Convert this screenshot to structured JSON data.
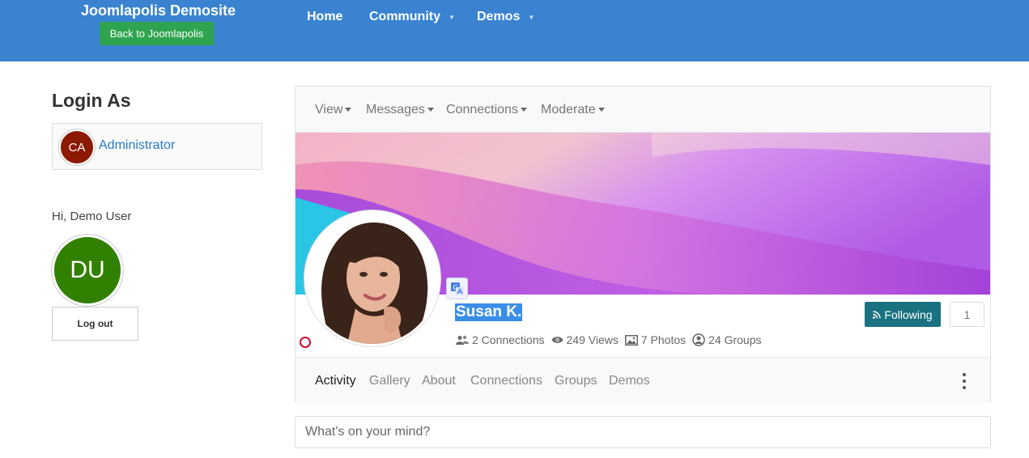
{
  "header": {
    "brand": "Joomlapolis Demosite",
    "back_button": "Back to Joomlapolis",
    "nav": [
      {
        "label": "Home",
        "has_caret": false
      },
      {
        "label": "Community",
        "has_caret": true
      },
      {
        "label": "Demos",
        "has_caret": true
      }
    ]
  },
  "sidebar": {
    "login_as_title": "Login As",
    "login_user": {
      "initials": "CA",
      "name": "Administrator",
      "color": "#8b1a00"
    },
    "greeting": "Hi, Demo User",
    "current_user": {
      "initials": "DU",
      "color": "#318000"
    },
    "logout_label": "Log out"
  },
  "profile": {
    "menu": [
      "View",
      "Messages",
      "Connections",
      "Moderate"
    ],
    "name": "Susan K.",
    "stats": {
      "connections": "2 Connections",
      "views": "249 Views",
      "photos": "7 Photos",
      "groups": "24 Groups"
    },
    "follow_label": "Following",
    "follow_count": "1",
    "tabs": [
      "Activity",
      "Gallery",
      "About",
      "Connections",
      "Groups",
      "Demos"
    ],
    "active_tab": "Activity"
  },
  "composer": {
    "placeholder": "What's on your mind?"
  },
  "colors": {
    "header": "#3a83d0",
    "follow_button": "#1a7180",
    "back_button": "#2fa44f"
  }
}
